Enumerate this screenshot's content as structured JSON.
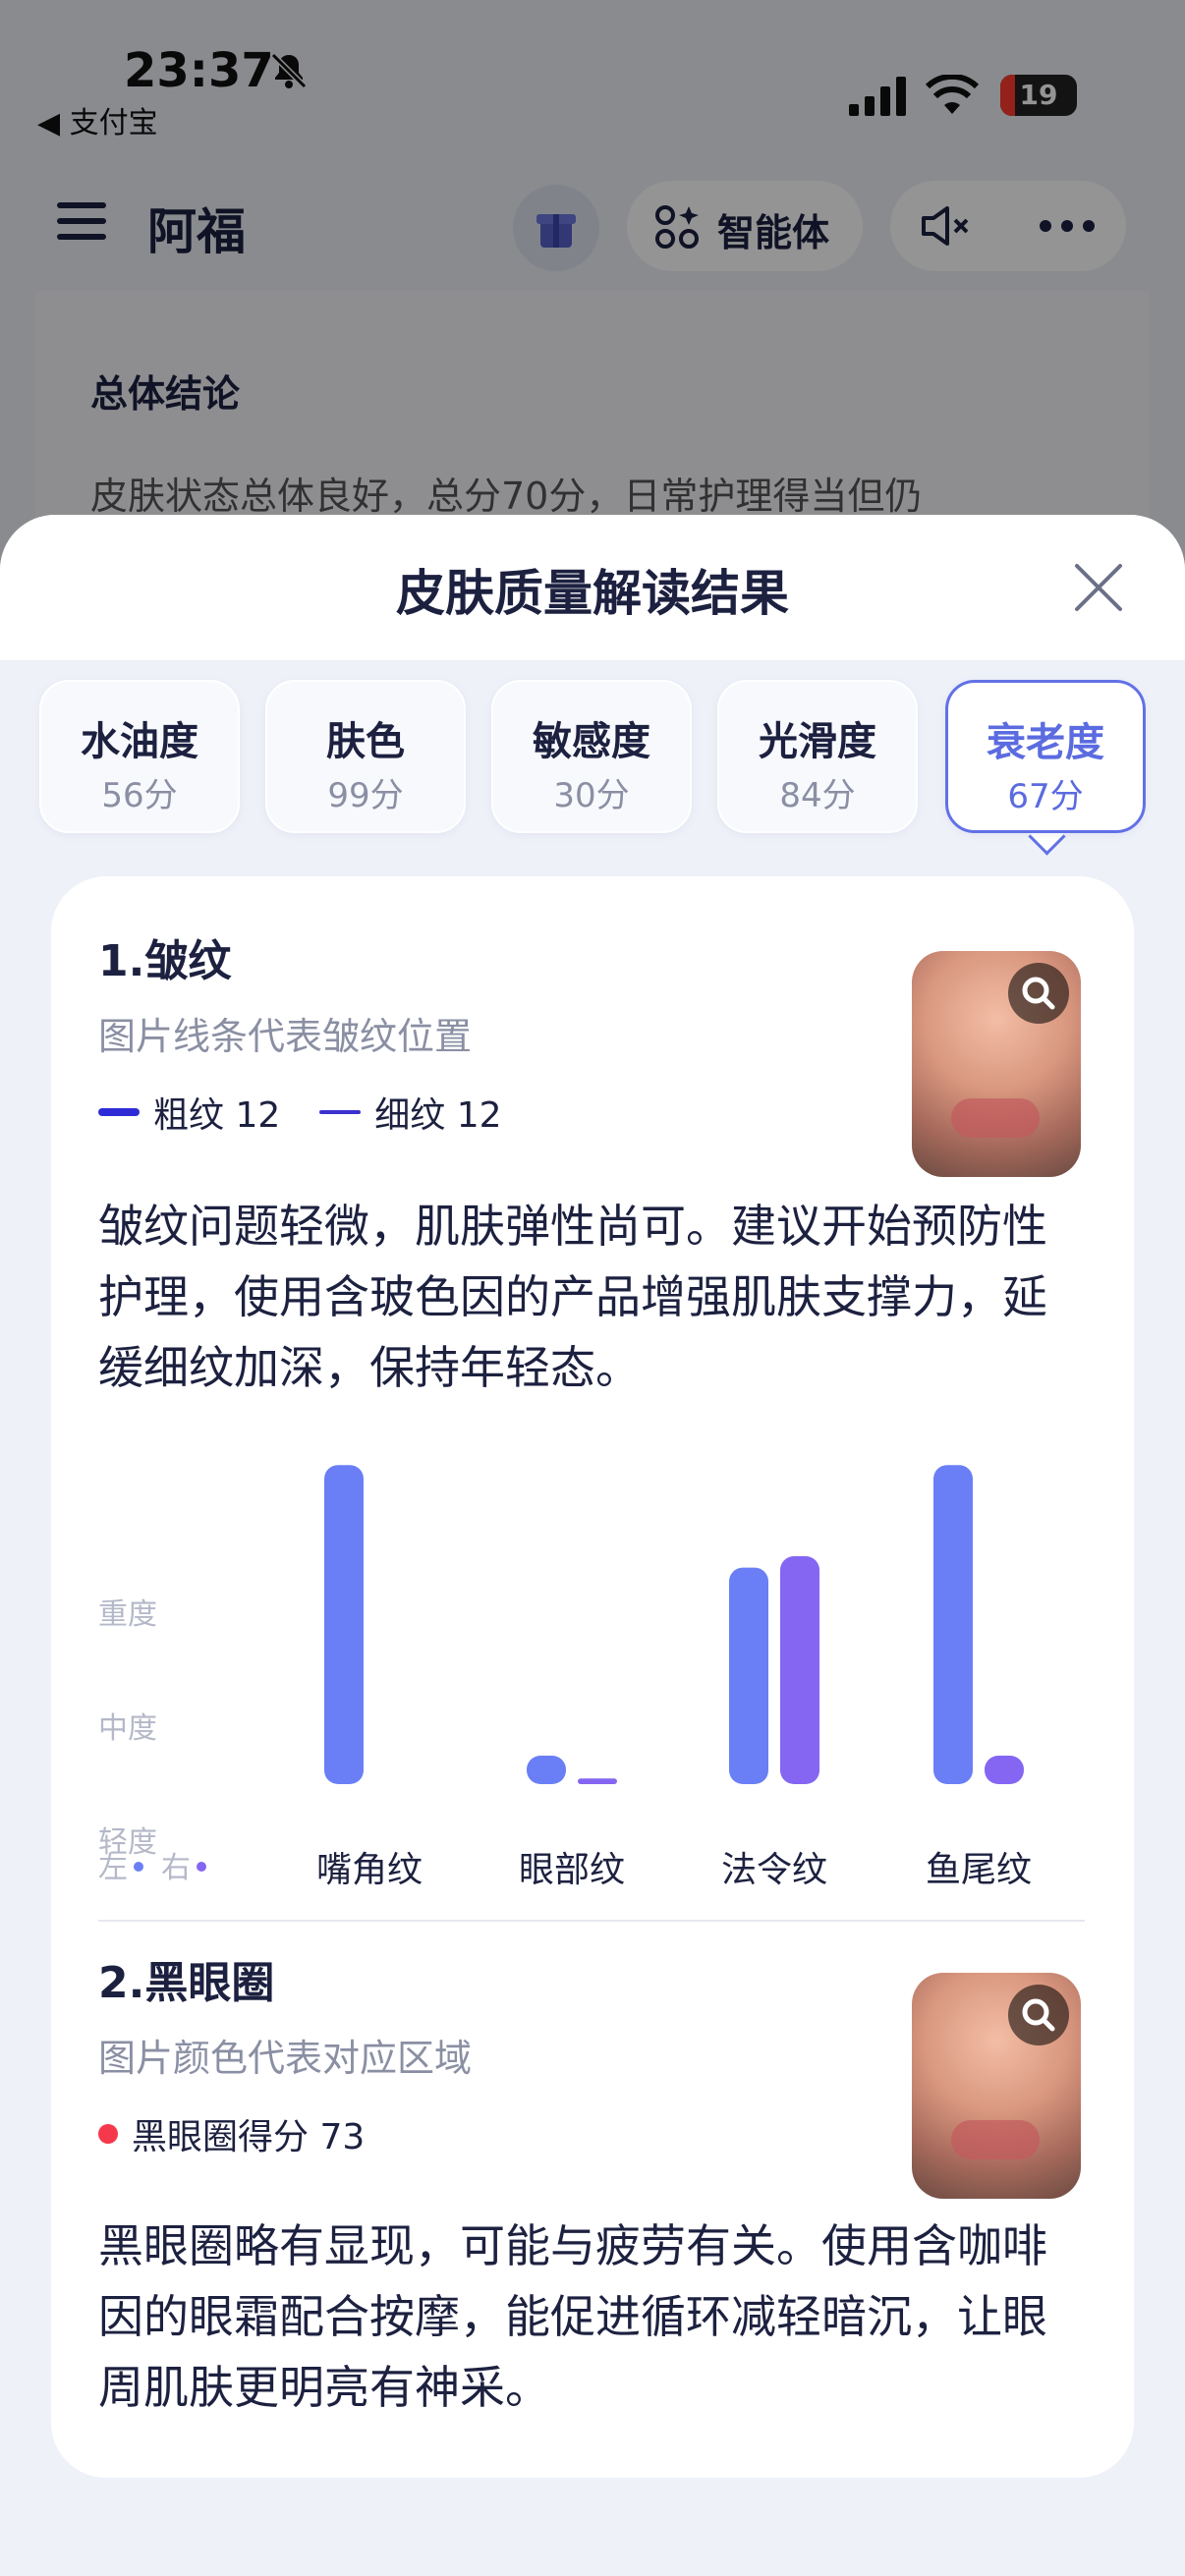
{
  "status_bar": {
    "time": "23:37",
    "back_app": "◀ 支付宝",
    "battery": "19",
    "battery_level": 0.19
  },
  "header": {
    "title": "阿福",
    "agent_label": "智能体"
  },
  "bg_card": {
    "title": "总体结论",
    "text": "皮肤状态总体良好，总分70分，日常护理得当但仍"
  },
  "sheet": {
    "title": "皮肤质量解读结果",
    "tabs": [
      {
        "name": "水油度",
        "score": "56分"
      },
      {
        "name": "肤色",
        "score": "99分"
      },
      {
        "name": "敏感度",
        "score": "30分"
      },
      {
        "name": "光滑度",
        "score": "84分"
      },
      {
        "name": "衰老度",
        "score": "67分",
        "active": true
      }
    ]
  },
  "wrinkle": {
    "title": "1.皱纹",
    "subtitle": "图片线条代表皱纹位置",
    "legend_coarse": "粗纹 12",
    "legend_fine": "细纹 12",
    "description": "皱纹问题轻微，肌肤弹性尚可。建议开始预防性护理，使用含玻色因的产品增强肌肤支撑力，延缓细纹加深，保持年轻态。"
  },
  "chart_data": {
    "type": "bar",
    "categories": [
      "嘴角纹",
      "眼部纹",
      "法令纹",
      "鱼尾纹"
    ],
    "y_levels": [
      "轻度",
      "中度",
      "重度"
    ],
    "ylim": [
      0,
      3
    ],
    "side_labels": {
      "left": "左",
      "right": "右"
    },
    "series": [
      {
        "side": "左",
        "color": "#6a7ff5",
        "values": [
          2.8,
          0.25,
          1.9,
          2.8
        ]
      },
      {
        "side": "右",
        "color": "#8466f2",
        "values": [
          0,
          0.05,
          2.0,
          0.25
        ]
      }
    ]
  },
  "dark_circle": {
    "title": "2.黑眼圈",
    "subtitle": "图片颜色代表对应区域",
    "legend": "黑眼圈得分 73",
    "description": "黑眼圈略有显现，可能与疲劳有关。使用含咖啡因的眼霜配合按摩，能促进循环减轻暗沉，让眼周肌肤更明亮有神采。"
  },
  "colors": {
    "accent": "#6271e6",
    "text": "#1d2140",
    "dot_red": "#f5384b",
    "legend_coarse": "#2e2bd6",
    "legend_fine": "#3b31cf"
  }
}
